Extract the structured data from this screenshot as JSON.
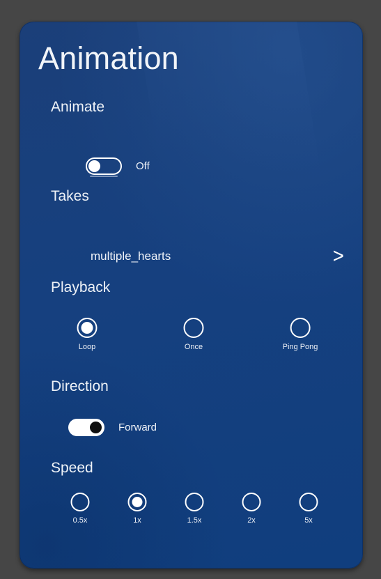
{
  "window": {
    "backdrop_color": "#464646"
  },
  "panel": {
    "title": "Animation",
    "background_color": "#16407f",
    "accent_color": "#ffffff"
  },
  "animate": {
    "label": "Animate",
    "toggle_state": "off",
    "toggle_caption": "Off"
  },
  "takes": {
    "label": "Takes",
    "value": "multiple_hearts",
    "chevron_icon": ">"
  },
  "playback": {
    "label": "Playback",
    "options": [
      {
        "label": "Loop",
        "selected": true
      },
      {
        "label": "Once",
        "selected": false
      },
      {
        "label": "Ping Pong",
        "selected": false
      }
    ]
  },
  "direction": {
    "label": "Direction",
    "toggle_state": "on",
    "toggle_caption": "Forward"
  },
  "speed": {
    "label": "Speed",
    "options": [
      {
        "label": "0.5x",
        "selected": false
      },
      {
        "label": "1x",
        "selected": true
      },
      {
        "label": "1.5x",
        "selected": false
      },
      {
        "label": "2x",
        "selected": false
      },
      {
        "label": "5x",
        "selected": false
      }
    ]
  }
}
